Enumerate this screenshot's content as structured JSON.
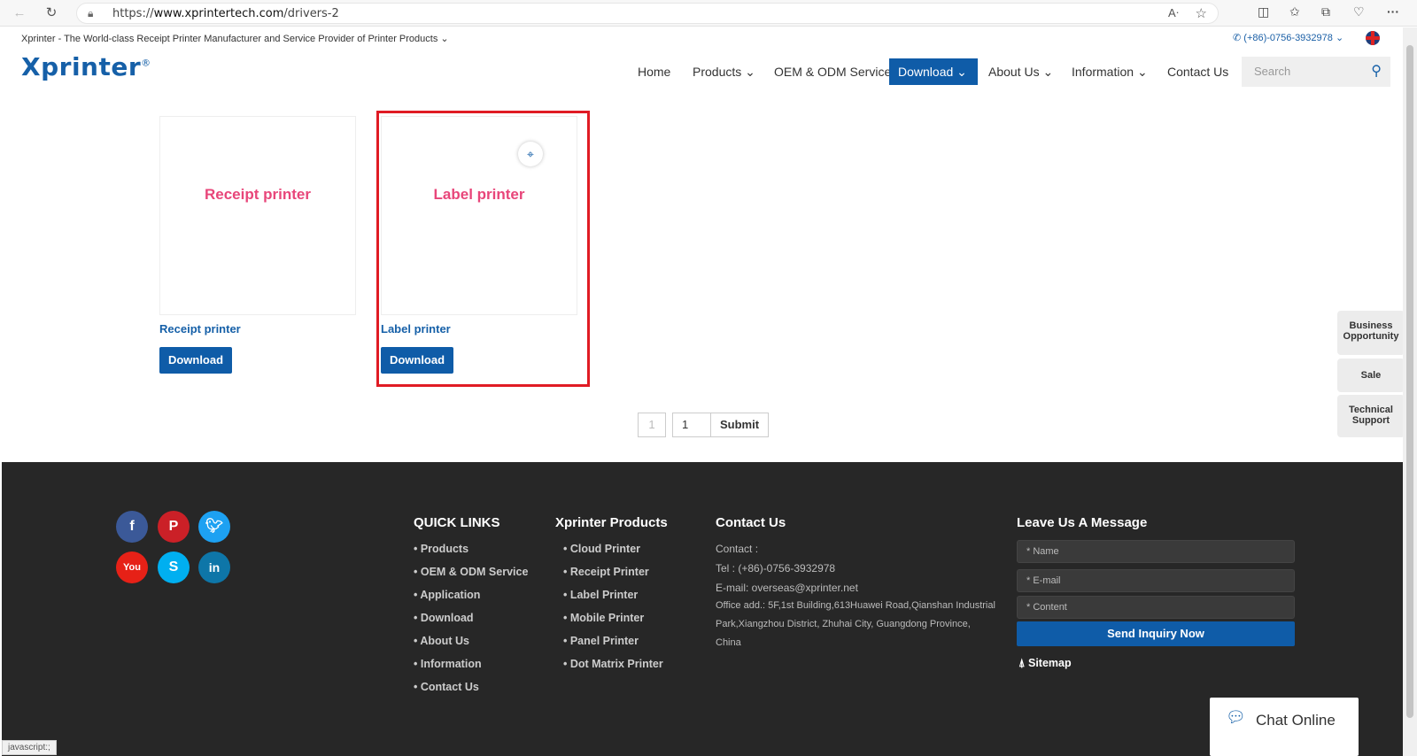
{
  "browser": {
    "url_prefix": "https://",
    "url_domain": "www.xprintertech.com",
    "url_path": "/drivers-2",
    "status_text": "javascript:;"
  },
  "header": {
    "tagline": "Xprinter - The World-class Receipt Printer Manufacturer and Service Provider of Printer Products",
    "phone": "(+86)-0756-3932978",
    "logo": "Xprinter",
    "logo_mark": "®"
  },
  "nav": {
    "items": [
      {
        "label": "Home"
      },
      {
        "label": "Products"
      },
      {
        "label": "OEM & ODM Service"
      },
      {
        "label": "Download"
      },
      {
        "label": "About Us"
      },
      {
        "label": "Information"
      },
      {
        "label": "Contact Us"
      }
    ],
    "search_placeholder": "Search"
  },
  "cards": [
    {
      "image_text": "Receipt printer",
      "title": "Receipt printer",
      "button": "Download"
    },
    {
      "image_text": "Label printer",
      "title": "Label printer",
      "button": "Download"
    }
  ],
  "pager": {
    "current": "1",
    "input_value": "1",
    "submit": "Submit"
  },
  "side_tabs": [
    "Business Opportunity",
    "Sale",
    "Technical Support"
  ],
  "footer": {
    "quick_links_title": "QUICK LINKS",
    "quick_links": [
      "• Products",
      "• OEM & ODM Service",
      "• Application",
      "• Download",
      "• About Us",
      "• Information",
      "• Contact Us"
    ],
    "products_title": "Xprinter Products",
    "products": [
      "• Cloud Printer",
      "• Receipt Printer",
      "• Label Printer",
      "• Mobile Printer",
      "• Panel Printer",
      "• Dot Matrix Printer"
    ],
    "contact_title": "Contact Us",
    "contact_lines": [
      "Contact :",
      "Tel : (+86)-0756-3932978",
      "E-mail: overseas@xprinter.net"
    ],
    "address_lines": [
      "Office add.: 5F,1st Building,613Huawei Road,Qianshan Industrial",
      "Park,Xiangzhou District, Zhuhai City, Guangdong Province,",
      "China"
    ],
    "message_title": "Leave Us  A Message",
    "name_placeholder": "* Name",
    "email_placeholder": "* E-mail",
    "content_placeholder": "* Content",
    "send_label": "Send Inquiry Now",
    "sitemap": "Sitemap",
    "social": [
      "facebook",
      "pinterest",
      "twitter",
      "youtube",
      "skype",
      "linkedin"
    ]
  },
  "chat": {
    "label": "Chat Online"
  },
  "colors": {
    "brand": "#0f5ca8",
    "accent_pink": "#e8467a",
    "highlight": "#e01b24",
    "footer_bg": "#272727"
  }
}
